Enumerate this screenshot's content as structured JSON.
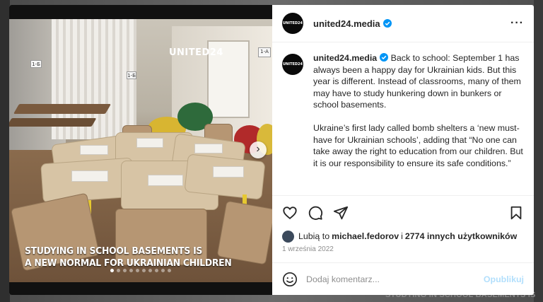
{
  "backdrop": {
    "footer_text": "STUDYING IN SCHOOL BASEMENTS IS"
  },
  "media": {
    "watermark": "UNITED24",
    "overlay_line1": "STUDYING IN SCHOOL BASEMENTS IS",
    "overlay_line2": "A NEW NORMAL FOR UKRAINIAN CHILDREN",
    "sign_left": "1-Б",
    "sign_left2": "1-Б",
    "sign_right": "1-А",
    "carousel_total": 10,
    "carousel_active": 1
  },
  "post": {
    "account": "united24.media",
    "avatar_text": "UNITED24",
    "caption_user": "united24.media",
    "caption_p1": "Back to school: September 1 has always been a happy day for Ukrainian kids. But this year is different. Instead of classrooms, many of them may have to study hunkering down in bunkers or school basements.",
    "caption_p2": "Ukraine’s first lady called bomb shelters a ‘new must-have for Ukrainian schools’, adding that “No one can take away the right to education from our children. But it is our responsibility to ensure its safe conditions.”",
    "likes_prefix": "Lubią to",
    "likes_user": "michael.fedorov",
    "likes_mid": "i",
    "likes_others": "2774 innych użytkowników",
    "date": "1 września 2022"
  },
  "comment": {
    "placeholder": "Dodaj komentarz...",
    "publish_label": "Opublikuj"
  },
  "colors": {
    "verified": "#0095f6",
    "publish_disabled": "#b2dffc"
  }
}
